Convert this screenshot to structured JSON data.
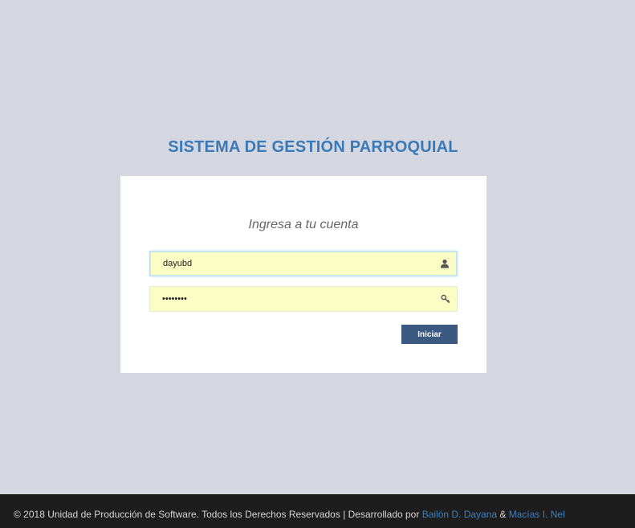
{
  "header": {
    "title": "SISTEMA DE GESTIÓN PARROQUIAL"
  },
  "login": {
    "subtitle": "Ingresa a tu cuenta",
    "username_value": "dayubd",
    "password_value": "••••••••",
    "username_icon": "user-icon",
    "password_icon": "key-icon",
    "submit_label": "Iniciar"
  },
  "footer": {
    "copyright": "© 2018 Unidad de Producción de Software. Todos los Derechos Reservados | Desarrollado por ",
    "author1": "Bailón D. Dayana",
    "separator": " & ",
    "author2": "Macías I. Nel"
  },
  "colors": {
    "background": "#d4d7e0",
    "title": "#3a7ab8",
    "button": "#3b5a82",
    "input_fill": "#fafdc4",
    "footer_bg": "#1d1d1d",
    "footer_link": "#3a82c4"
  }
}
